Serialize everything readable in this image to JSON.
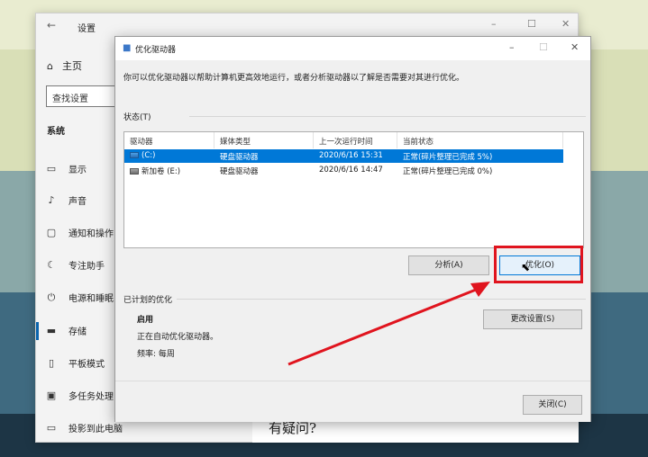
{
  "settings": {
    "title": "设置",
    "back_icon": "back-arrow-icon",
    "window_controls": [
      "–",
      "☐",
      "✕"
    ],
    "home_label": "主页",
    "search_placeholder": "查找设置",
    "section": "系统",
    "nav": [
      {
        "label": "显示",
        "icon": "monitor-icon"
      },
      {
        "label": "声音",
        "icon": "speaker-icon"
      },
      {
        "label": "通知和操作",
        "icon": "notification-icon"
      },
      {
        "label": "专注助手",
        "icon": "moon-icon"
      },
      {
        "label": "电源和睡眠",
        "icon": "power-icon"
      },
      {
        "label": "存储",
        "icon": "storage-icon"
      },
      {
        "label": "平板模式",
        "icon": "tablet-icon"
      },
      {
        "label": "多任务处理",
        "icon": "multitask-icon"
      },
      {
        "label": "投影到此电脑",
        "icon": "project-icon"
      }
    ],
    "help_text": "有疑问?"
  },
  "dialog": {
    "title": "优化驱动器",
    "window_controls": [
      "–",
      "☐",
      "✕"
    ],
    "description": "你可以优化驱动器以帮助计算机更高效地运行，或者分析驱动器以了解是否需要对其进行优化。",
    "status_label": "状态(T)",
    "columns": [
      "驱动器",
      "媒体类型",
      "上一次运行时间",
      "当前状态"
    ],
    "drives": [
      {
        "name": "(C:)",
        "media": "硬盘驱动器",
        "last_run": "2020/6/16 15:31",
        "status": "正常(碎片整理已完成 5%)",
        "selected": true
      },
      {
        "name": "新加卷 (E:)",
        "media": "硬盘驱动器",
        "last_run": "2020/6/16 14:47",
        "status": "正常(碎片整理已完成 0%)",
        "selected": false
      }
    ],
    "analyze_button": "分析(A)",
    "optimize_button": "优化(O)",
    "scheduled_label": "已计划的优化",
    "schedule_state": "启用",
    "schedule_desc": "正在自动优化驱动器。",
    "frequency": "频率: 每周",
    "change_settings_button": "更改设置(S)",
    "close_button": "关闭(C)"
  },
  "colors": {
    "selection": "#0078d7",
    "annotation_red": "#e0141e"
  }
}
